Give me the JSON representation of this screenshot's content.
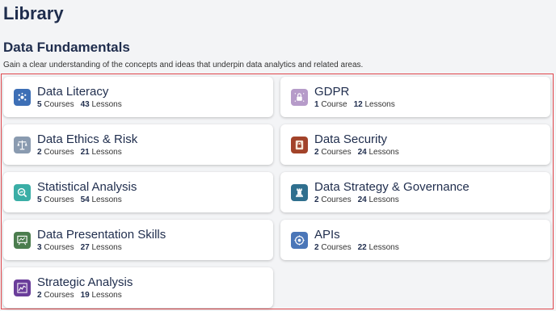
{
  "page": {
    "title": "Library"
  },
  "section": {
    "title": "Data Fundamentals",
    "description": "Gain a clear understanding of the concepts and ideas that underpin data analytics and related areas."
  },
  "labels": {
    "courses": "Courses",
    "lessons": "Lessons"
  },
  "cards": [
    {
      "title": "Data Literacy",
      "courses": "5",
      "lessons": "43",
      "icon": "data-literacy-icon",
      "color": "#3d6fb6"
    },
    {
      "title": "GDPR",
      "courses": "1",
      "lessons": "12",
      "icon": "lock-icon",
      "color": "#b69bc9"
    },
    {
      "title": "Data Ethics & Risk",
      "courses": "2",
      "lessons": "21",
      "icon": "scales-icon",
      "color": "#8a9bb0"
    },
    {
      "title": "Data Security",
      "courses": "2",
      "lessons": "24",
      "icon": "padlock-icon",
      "color": "#a2432a"
    },
    {
      "title": "Statistical Analysis",
      "courses": "5",
      "lessons": "54",
      "icon": "magnifier-chart-icon",
      "color": "#3aaea6"
    },
    {
      "title": "Data Strategy & Governance",
      "courses": "2",
      "lessons": "24",
      "icon": "chess-rook-icon",
      "color": "#2f6f8e"
    },
    {
      "title": "Data Presentation Skills",
      "courses": "3",
      "lessons": "27",
      "icon": "presentation-board-icon",
      "color": "#4b7d4e"
    },
    {
      "title": "APIs",
      "courses": "2",
      "lessons": "22",
      "icon": "api-cloud-icon",
      "color": "#4a76b8"
    },
    {
      "title": "Strategic Analysis",
      "courses": "2",
      "lessons": "19",
      "icon": "line-chart-icon",
      "color": "#6a3d9a"
    }
  ]
}
